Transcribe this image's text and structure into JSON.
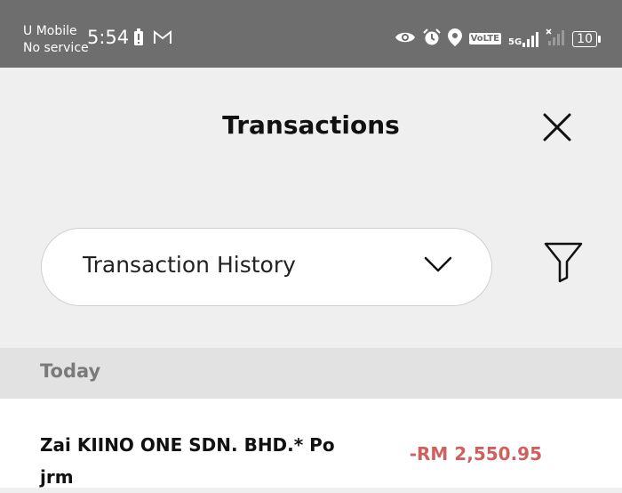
{
  "status_bar": {
    "carrier_line1": "U Mobile",
    "carrier_line2": "No service",
    "time": "5:54",
    "network": "5G",
    "volte": "VoLTE",
    "battery": "10"
  },
  "header": {
    "title": "Transactions"
  },
  "filter_bar": {
    "dropdown_value": "Transaction History"
  },
  "sections": [
    {
      "label": "Today",
      "transactions": [
        {
          "merchant": "Zai KIINO ONE SDN. BHD.* Po jrm",
          "amount": "-RM 2,550.95"
        }
      ]
    }
  ],
  "colors": {
    "status_bar_bg": "#6e6e6e",
    "page_bg": "#efefef",
    "debit_amount": "#d0605e"
  }
}
